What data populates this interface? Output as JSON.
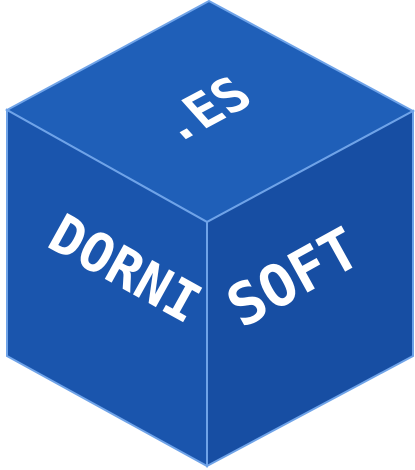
{
  "logo": {
    "text_top": ".ES",
    "text_left": "DORNI",
    "text_right": "SOFT"
  },
  "colors": {
    "top_face": "#1f5fb8",
    "left_face": "#1a55ad",
    "right_face": "#174ea3",
    "edge": "#6fa3e8",
    "text": "#ffffff"
  }
}
